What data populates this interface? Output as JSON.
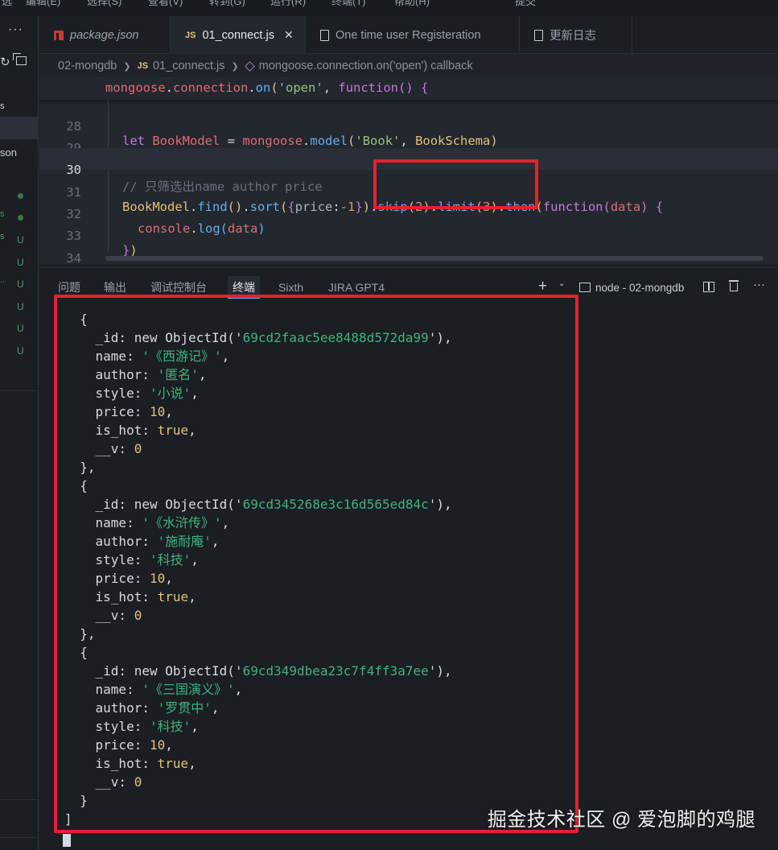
{
  "menubar": {
    "items": [
      "选",
      "编辑(E)",
      "选择(S)",
      "查看(V)",
      "转到(G)",
      "运行(R)",
      "终端(T)",
      "帮助(H)",
      "提交"
    ]
  },
  "sidebar": {
    "more_icon": "more-icon",
    "entries": [
      {
        "text": "son"
      },
      {
        "text": "s"
      },
      {
        "text": "s"
      },
      {
        "text": ".."
      }
    ],
    "status_letter": "U"
  },
  "tabs": [
    {
      "label": "package.json",
      "icon": "npm-icon",
      "italic": true
    },
    {
      "label": "01_connect.js",
      "icon": "js-icon",
      "active": true,
      "close": "✕"
    },
    {
      "label": "One time user Registeration",
      "icon": "file-icon"
    },
    {
      "label": "更新日志",
      "icon": "file-icon"
    }
  ],
  "breadcrumb": {
    "folder": "02-mongdb",
    "file": "01_connect.js",
    "symbol": "mongoose.connection.on('open') callback"
  },
  "editor": {
    "sticky_line": "mongoose.connection.on('open', function() {",
    "lines": [
      {
        "num": "28",
        "text": "let BookModel = mongoose.model('Book', BookSchema)"
      },
      {
        "num": "29",
        "text": ""
      },
      {
        "num": "30",
        "text": "// 只筛选出name author price"
      },
      {
        "num": "31",
        "text": "BookModel.find().sort({price:-1}).skip(2).limit(3).then(function(data) {"
      },
      {
        "num": "32",
        "text": "console.log(data)"
      },
      {
        "num": "33",
        "text": "})"
      },
      {
        "num": "34",
        "text": ""
      }
    ],
    "current_line": "30"
  },
  "panel": {
    "tabs": [
      "问题",
      "输出",
      "调试控制台",
      "终端",
      "Sixth",
      "JIRA GPT4"
    ],
    "active_tab": "终端",
    "add_label": "+",
    "terminal_name": "node - 02-mongdb",
    "more_label": "···"
  },
  "terminal": {
    "records": [
      {
        "id": "69cd2faac5ee8488d572da99",
        "name": "《西游记》",
        "author": "匿名",
        "style": "小说",
        "price": "10",
        "is_hot": "true",
        "v": "0"
      },
      {
        "id": "69cd345268e3c16d565ed84c",
        "name": "《水浒传》",
        "author": "施耐庵",
        "style": "科技",
        "price": "10",
        "is_hot": "true",
        "v": "0"
      },
      {
        "id": "69cd349dbea23c7f4ff3a7ee",
        "name": "《三国演义》",
        "author": "罗贯中",
        "style": "科技",
        "price": "10",
        "is_hot": "true",
        "v": "0"
      }
    ],
    "closing": "]"
  },
  "watermark": "掘金技术社区 @ 爱泡脚的鸡腿",
  "colors": {
    "annotation": "#e8202f",
    "accent": "#61afef"
  }
}
